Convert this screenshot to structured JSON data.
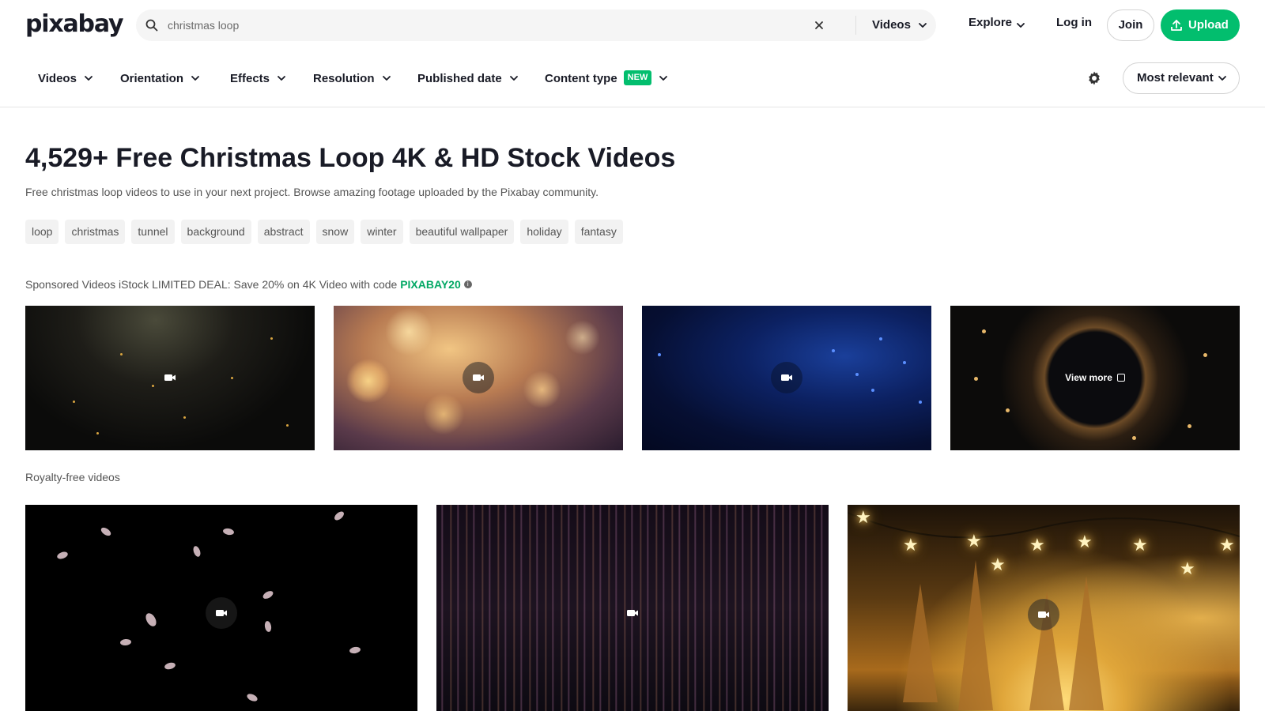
{
  "header": {
    "logo_text": "pixabay",
    "search": {
      "value": "christmas loop",
      "type_label": "Videos"
    },
    "explore_label": "Explore",
    "login_label": "Log in",
    "join_label": "Join",
    "upload_label": "Upload",
    "accent_color": "#02be6e"
  },
  "filters": {
    "items": [
      {
        "label": "Videos"
      },
      {
        "label": "Orientation"
      },
      {
        "label": "Effects"
      },
      {
        "label": "Resolution"
      },
      {
        "label": "Published date"
      },
      {
        "label": "Content type",
        "badge": "NEW"
      }
    ],
    "sort_label": "Most relevant"
  },
  "main": {
    "title": "4,529+ Free Christmas Loop 4K & HD Stock Videos",
    "subtitle": "Free christmas loop videos to use in your next project. Browse amazing footage uploaded by the Pixabay community.",
    "tags": [
      "loop",
      "christmas",
      "tunnel",
      "background",
      "abstract",
      "snow",
      "winter",
      "beautiful wallpaper",
      "holiday",
      "fantasy"
    ],
    "sponsored": {
      "text": "Sponsored Videos iStock LIMITED DEAL: Save 20% on 4K Video with code ",
      "code": "PIXABAY20",
      "view_more_label": "View more"
    },
    "royalty_free_label": "Royalty-free videos"
  }
}
